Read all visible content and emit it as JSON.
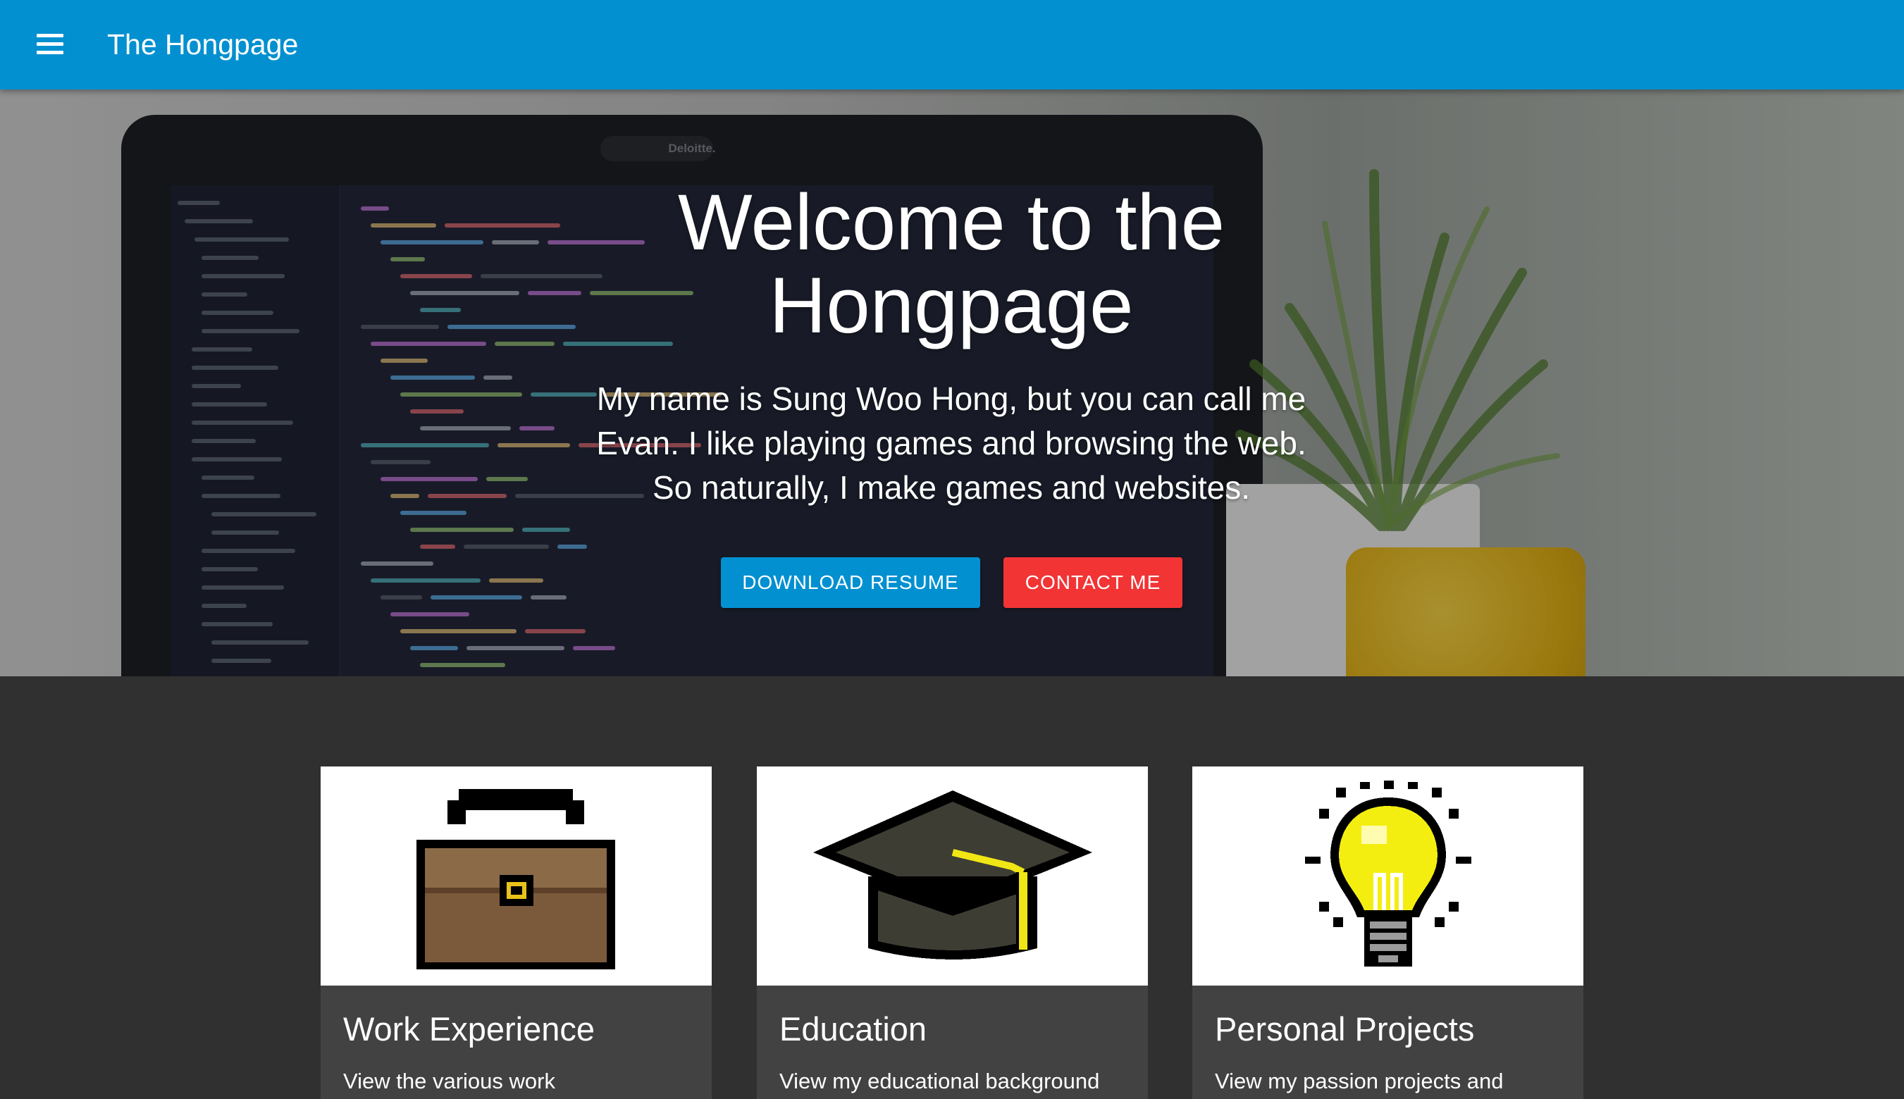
{
  "appbar": {
    "title": "The Hongpage",
    "menu_icon": "hamburger-menu-icon",
    "color": "#0290d0"
  },
  "hero": {
    "title": "Welcome to the Hongpage",
    "text": "My name is Sung Woo Hong, but you can call me Evan. I like playing games and browsing the web. So naturally, I make games and websites.",
    "laptop_brand": "Deloitte.",
    "buttons": {
      "resume": "DOWNLOAD RESUME",
      "contact": "CONTACT ME"
    },
    "colors": {
      "resume": "#0290d0",
      "contact": "#f23435"
    }
  },
  "cards": [
    {
      "title": "Work Experience",
      "text": "View the various work",
      "icon": "briefcase-icon"
    },
    {
      "title": "Education",
      "text": "View my educational background",
      "icon": "graduation-cap-icon"
    },
    {
      "title": "Personal Projects",
      "text": "View my passion projects and",
      "icon": "lightbulb-icon"
    }
  ]
}
